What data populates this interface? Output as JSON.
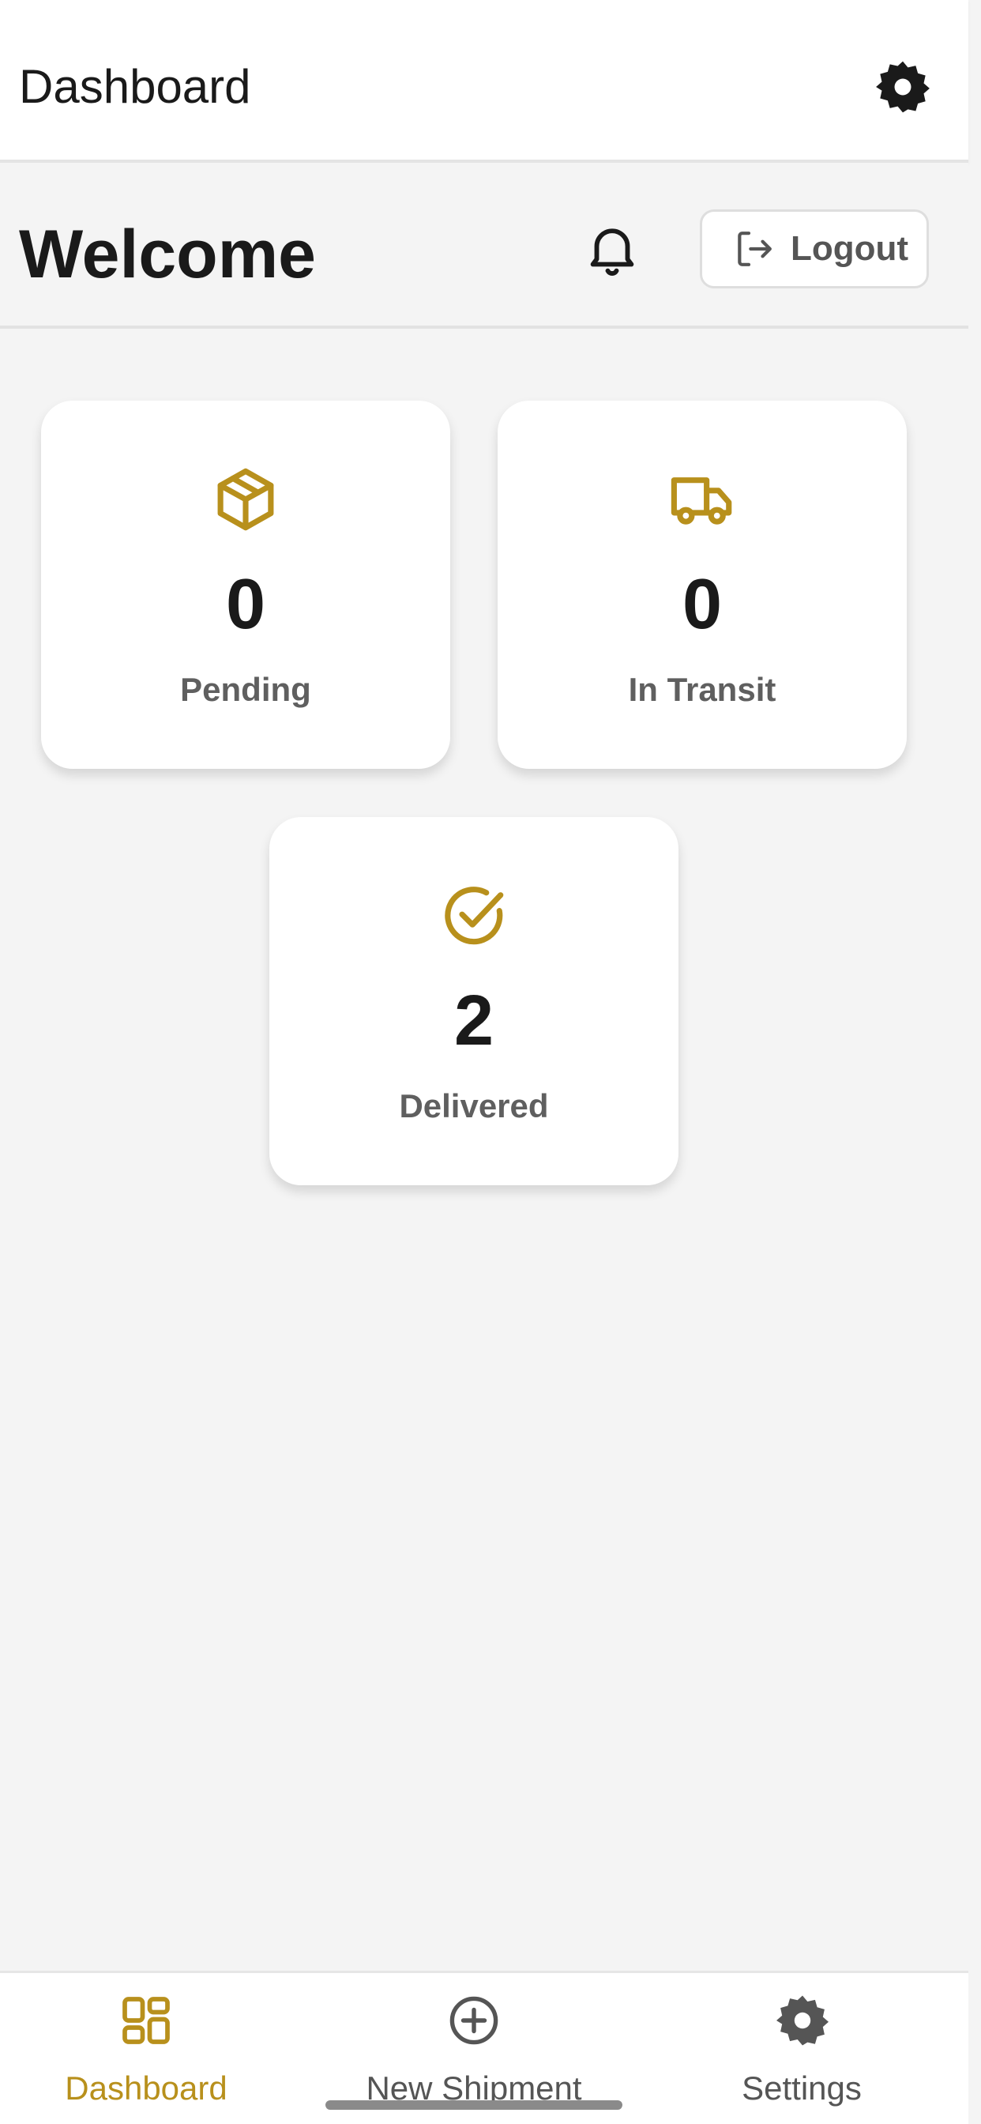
{
  "header": {
    "title": "Dashboard",
    "settings_icon": "gear-icon"
  },
  "welcome": {
    "title": "Welcome",
    "notifications_icon": "bell-icon",
    "logout_label": "Logout",
    "logout_icon": "logout-icon"
  },
  "stats": [
    {
      "icon": "package-icon",
      "count": "0",
      "label": "Pending"
    },
    {
      "icon": "truck-icon",
      "count": "0",
      "label": "In Transit"
    },
    {
      "icon": "check-circle-icon",
      "count": "2",
      "label": "Delivered"
    }
  ],
  "bottom_nav": {
    "items": [
      {
        "label": "Dashboard",
        "icon": "dashboard-grid-icon",
        "active": true
      },
      {
        "label": "New Shipment",
        "icon": "plus-circle-icon",
        "active": false
      },
      {
        "label": "Settings",
        "icon": "gear-icon",
        "active": false
      }
    ]
  },
  "colors": {
    "accent": "#b8901c",
    "background": "#f4f4f4",
    "card": "#ffffff",
    "text_primary": "#1a1a1a",
    "text_secondary": "#5f5f5f"
  }
}
